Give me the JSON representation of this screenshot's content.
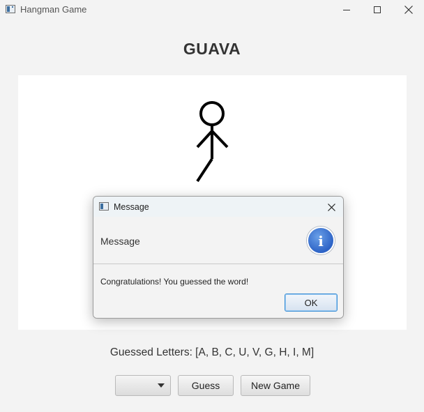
{
  "window": {
    "title": "Hangman Game",
    "icons": {
      "app": "app-icon",
      "minimize": "minimize-icon",
      "maximize": "maximize-icon",
      "close": "close-icon"
    }
  },
  "game": {
    "word": "GUAVA",
    "guessed_letters": "Guessed Letters: [A, B, C, U, V, G, H, I, M]",
    "drawing_parts": [
      "head",
      "body",
      "left-arm",
      "right-arm",
      "left-leg"
    ]
  },
  "controls": {
    "letter_select_value": "",
    "guess_label": "Guess",
    "new_game_label": "New Game"
  },
  "dialog": {
    "title": "Message",
    "header": "Message",
    "message": "Congratulations! You guessed the word!",
    "ok_label": "OK",
    "info_glyph": "i",
    "icons": {
      "app": "app-icon",
      "close": "close-icon",
      "info": "info-icon"
    }
  },
  "colors": {
    "window_bg": "#f3f3f3",
    "canvas_bg": "#ffffff",
    "info_blue": "#2d63c6",
    "ok_border": "#3b8fd6"
  }
}
